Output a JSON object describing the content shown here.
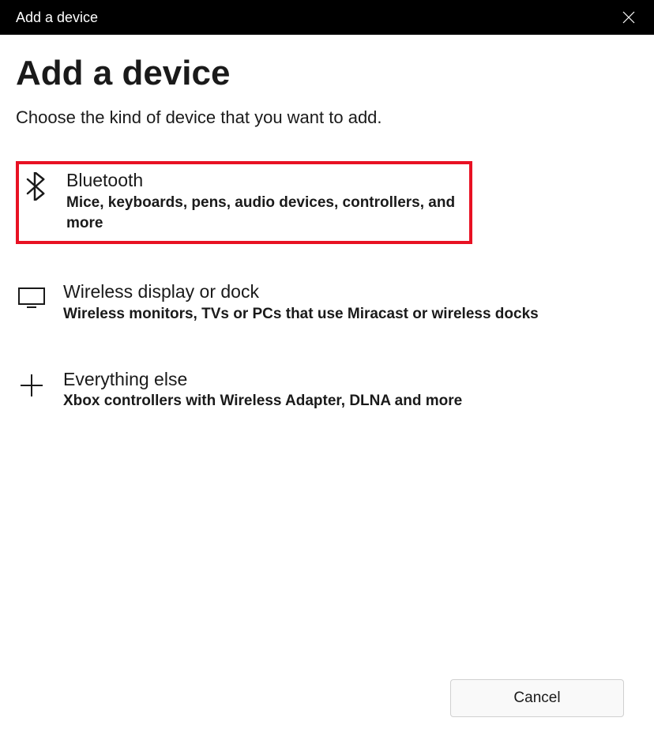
{
  "titlebar": {
    "title": "Add a device"
  },
  "main": {
    "title": "Add a device",
    "subtitle": "Choose the kind of device that you want to add."
  },
  "options": [
    {
      "title": "Bluetooth",
      "description": "Mice, keyboards, pens, audio devices, controllers, and more"
    },
    {
      "title": "Wireless display or dock",
      "description": "Wireless monitors, TVs or PCs that use Miracast or wireless docks"
    },
    {
      "title": "Everything else",
      "description": "Xbox controllers with Wireless Adapter, DLNA and more"
    }
  ],
  "footer": {
    "cancel_label": "Cancel"
  }
}
